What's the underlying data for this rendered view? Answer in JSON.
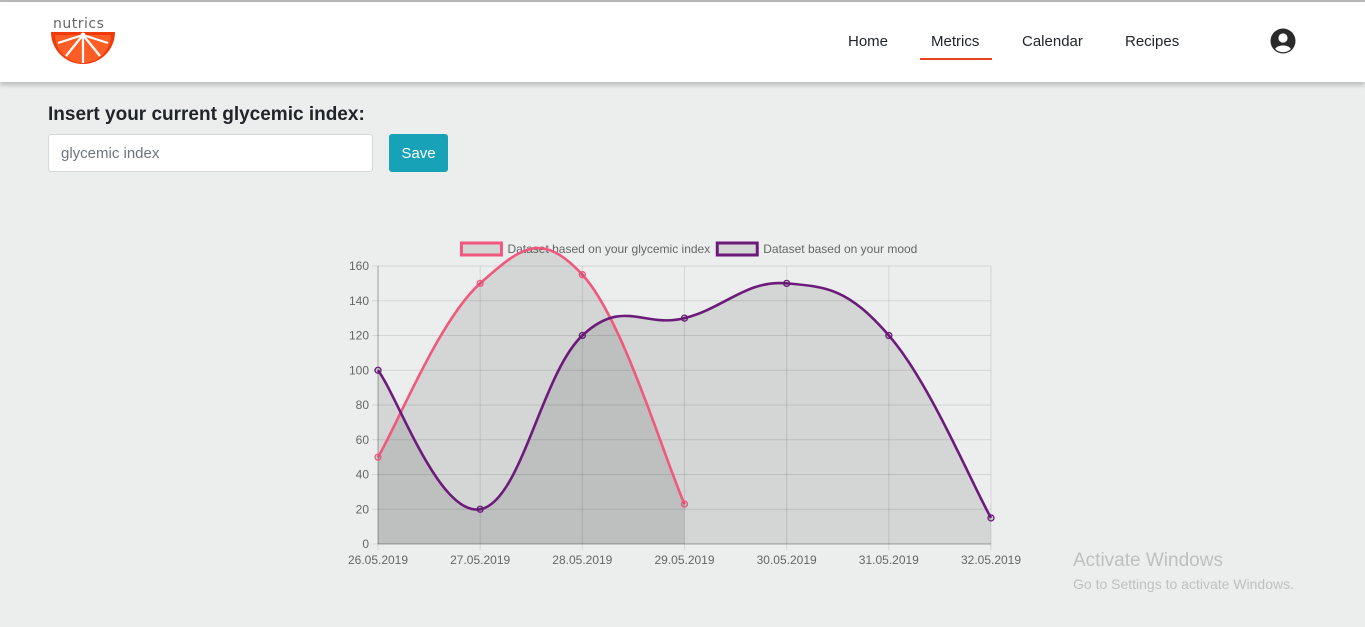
{
  "header": {
    "logo_text": "nutrics",
    "nav": [
      {
        "label": "Home"
      },
      {
        "label": "Metrics"
      },
      {
        "label": "Calendar"
      },
      {
        "label": "Recipes"
      }
    ],
    "active_tab": "Metrics",
    "accent_color": "#e8441e",
    "account_icon": "user-circle-icon"
  },
  "form": {
    "title": "Insert your current glycemic index:",
    "input_placeholder": "glycemic index",
    "input_value": "",
    "save_label": "Save",
    "save_color": "#17a2b8"
  },
  "chart_data": {
    "type": "line",
    "categories": [
      "26.05.2019",
      "27.05.2019",
      "28.05.2019",
      "29.05.2019",
      "30.05.2019",
      "31.05.2019",
      "32.05.2019"
    ],
    "series": [
      {
        "name": "Dataset based on your glycemic index",
        "values": [
          50,
          150,
          155,
          23
        ],
        "color": "#f0587e"
      },
      {
        "name": "Dataset based on your mood",
        "values": [
          100,
          20,
          120,
          130,
          150,
          120,
          15
        ],
        "color": "#6c1b7a"
      }
    ],
    "ylim": [
      0,
      160
    ],
    "yticks": [
      0,
      20,
      40,
      60,
      80,
      100,
      120,
      140,
      160
    ],
    "grid": true,
    "legend": "top",
    "fill": "area",
    "area_color": "rgba(0,0,0,0.1)"
  },
  "watermark": {
    "title": "Activate Windows",
    "subtitle": "Go to Settings to activate Windows."
  }
}
